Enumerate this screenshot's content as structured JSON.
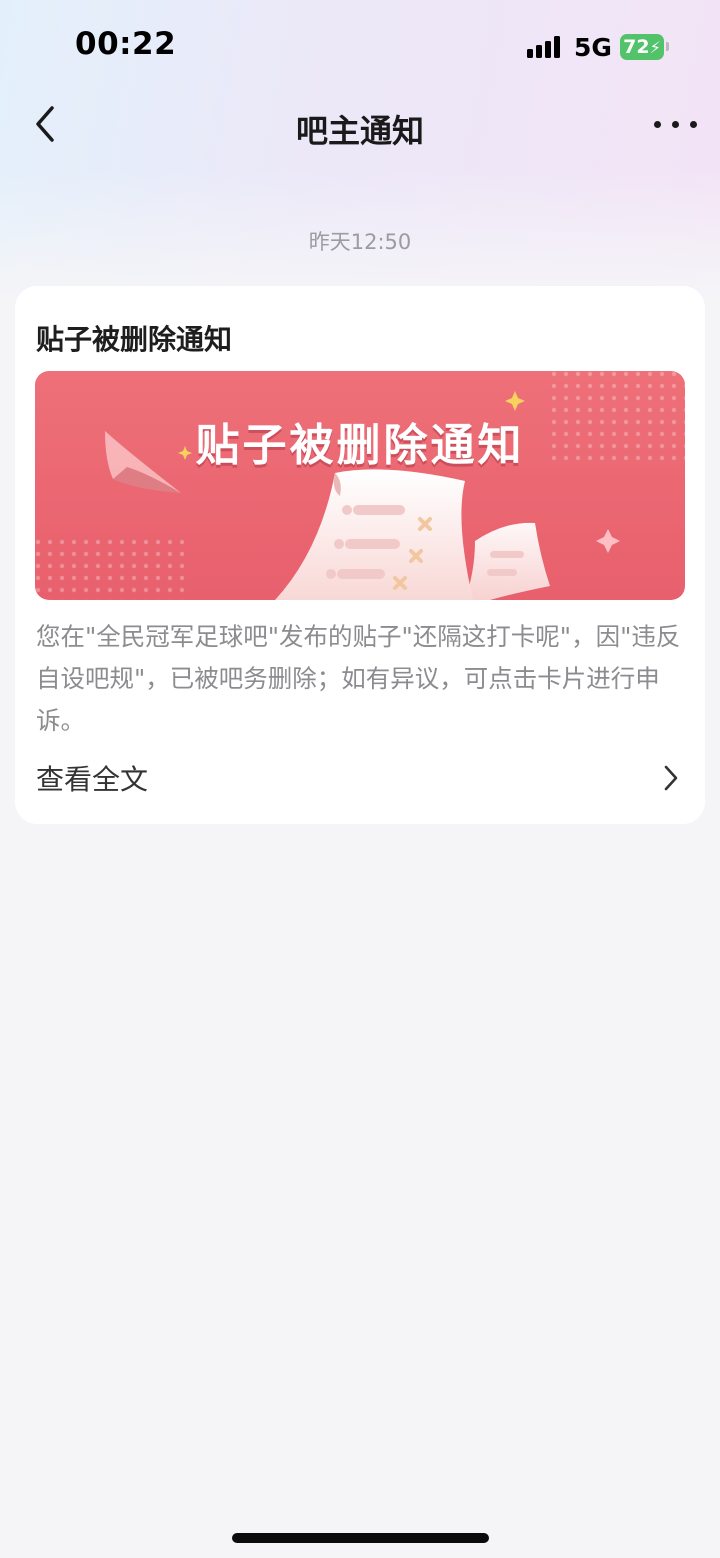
{
  "status_bar": {
    "time": "00:22",
    "network": "5G",
    "battery": "72"
  },
  "nav": {
    "title": "吧主通知"
  },
  "message": {
    "timestamp": "昨天12:50",
    "card_title": "贴子被删除通知",
    "banner_title": "贴子被删除通知",
    "body": "您在\"全民冠军足球吧\"发布的贴子\"还隔这打卡呢\"，因\"违反自设吧规\"，已被吧务删除；如有异议，可点击卡片进行申诉。",
    "view_full_label": "查看全文"
  },
  "colors": {
    "banner": "#e8606d",
    "battery": "#52c36a",
    "accent_star": "#f6d35c"
  },
  "icons": {
    "back": "chevron-left-icon",
    "more": "more-dots-icon",
    "view_full": "chevron-right-icon"
  }
}
